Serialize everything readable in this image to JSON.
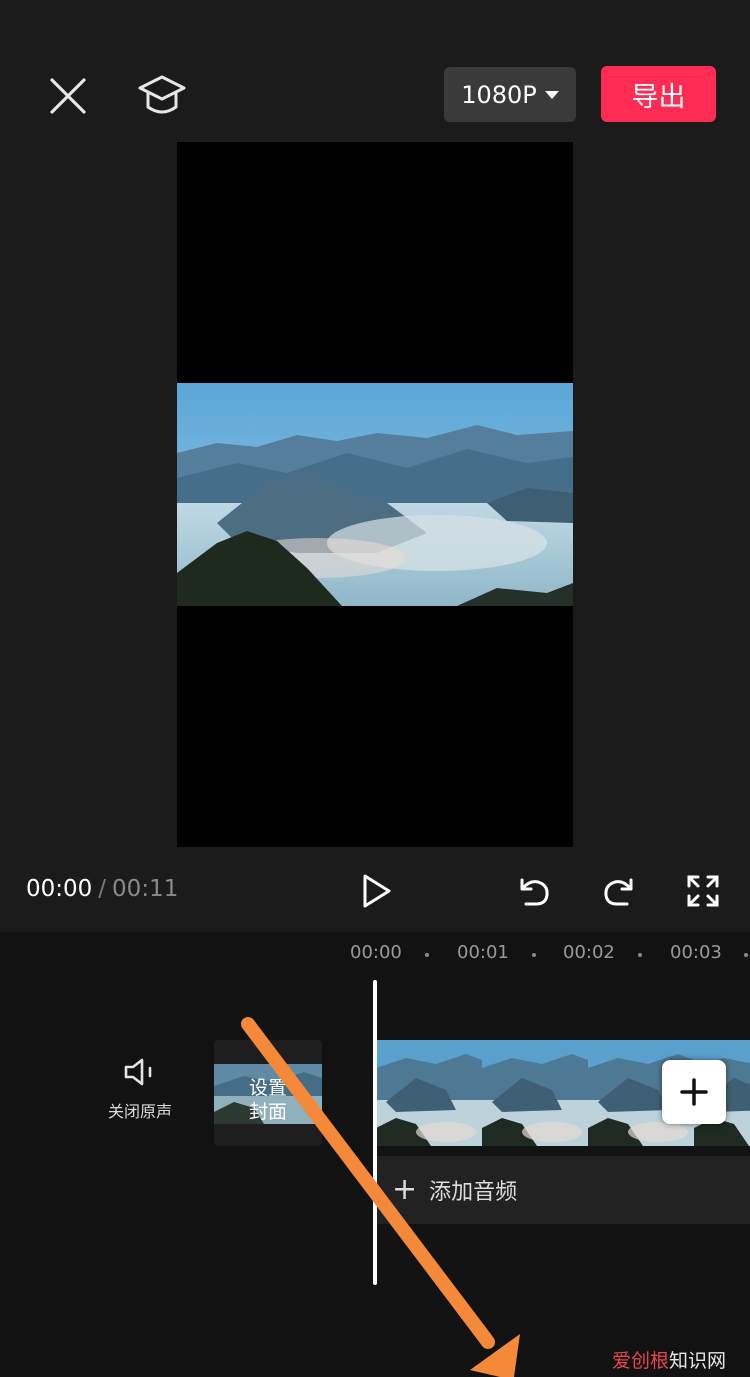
{
  "top_bar": {
    "resolution_label": "1080P",
    "export_label": "导出"
  },
  "playback": {
    "current_time": "00:00",
    "separator": "/",
    "total_time": "00:11"
  },
  "timeline": {
    "ruler_labels": [
      "00:00",
      "00:01",
      "00:02",
      "00:03"
    ],
    "mute_label": "关闭原声",
    "cover_label_line1": "设置",
    "cover_label_line2": "封面",
    "add_audio_label": "添加音频",
    "add_clip_symbol": "+",
    "add_audio_symbol": "+"
  },
  "watermark": {
    "part1": "爱创根",
    "part2": "知识网"
  },
  "colors": {
    "background": "#1b1b1b",
    "timeline_background": "#121212",
    "export_accent": "#fe2c55",
    "annotation_arrow": "#f5893a"
  },
  "icons": [
    "close-icon",
    "learn-cap-icon",
    "dropdown-caret-icon",
    "play-icon",
    "undo-icon",
    "redo-icon",
    "fullscreen-icon",
    "speaker-icon",
    "plus-icon"
  ]
}
